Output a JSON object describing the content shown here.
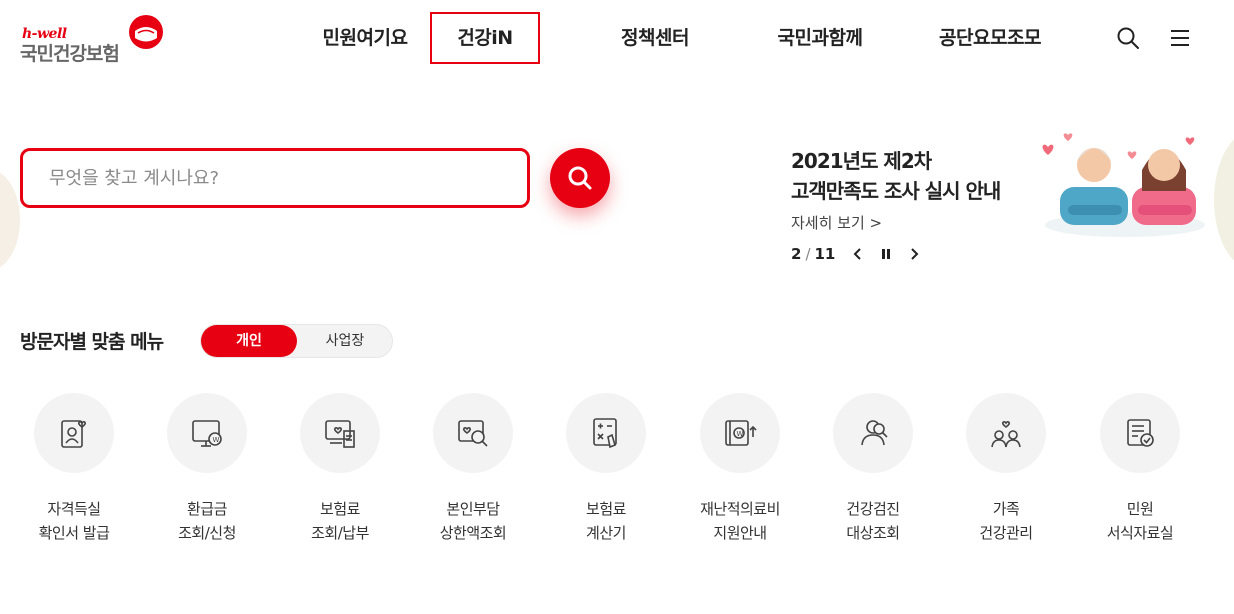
{
  "logo": {
    "small": "h-well",
    "main": "국민건강보험"
  },
  "nav": [
    {
      "label": "민원여기요"
    },
    {
      "label": "건강iN"
    },
    {
      "label": "정책센터"
    },
    {
      "label": "국민과함께"
    },
    {
      "label": "공단요모조모"
    }
  ],
  "search": {
    "placeholder": "무엇을 찾고 계시나요?"
  },
  "banner": {
    "title_line1": "2021년도 제2차",
    "title_line2": "고객만족도 조사 실시 안내",
    "more": "자세히 보기 >",
    "current": "2",
    "separator": "/",
    "total": "11"
  },
  "visitor": {
    "title": "방문자별 맞춤 메뉴",
    "options": [
      "개인",
      "사업장"
    ]
  },
  "quick_menu": [
    {
      "icon": "certificate-icon",
      "line1": "자격득실",
      "line2": "확인서 발급"
    },
    {
      "icon": "refund-monitor-icon",
      "line1": "환급금",
      "line2": "조회/신청"
    },
    {
      "icon": "premium-bill-icon",
      "line1": "보험료",
      "line2": "조회/납부"
    },
    {
      "icon": "copay-search-icon",
      "line1": "본인부담",
      "line2": "상한액조회"
    },
    {
      "icon": "calculator-icon",
      "line1": "보험료",
      "line2": "계산기"
    },
    {
      "icon": "medical-aid-icon",
      "line1": "재난적의료비",
      "line2": "지원안내"
    },
    {
      "icon": "checkup-search-icon",
      "line1": "건강검진",
      "line2": "대상조회"
    },
    {
      "icon": "family-icon",
      "line1": "가족",
      "line2": "건강관리"
    },
    {
      "icon": "forms-icon",
      "line1": "민원",
      "line2": "서식자료실"
    }
  ],
  "colors": {
    "accent": "#e60012",
    "circle_bg": "#f3f3f3"
  }
}
